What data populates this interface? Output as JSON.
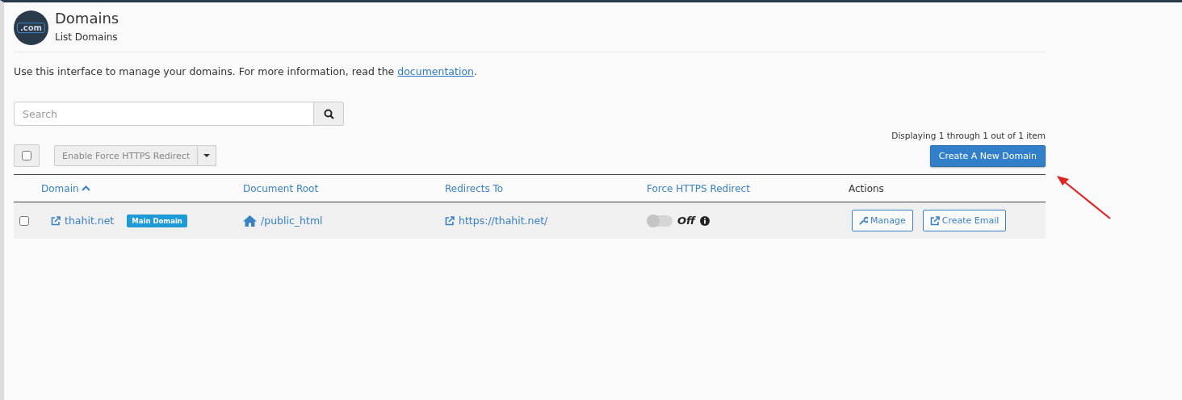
{
  "header": {
    "title": "Domains",
    "subtitle": "List Domains",
    "logo_text": ".com"
  },
  "intro": {
    "text": "Use this interface to manage your domains. For more information, read the ",
    "link": "documentation",
    "end": "."
  },
  "search": {
    "placeholder": "Search"
  },
  "paging": "Displaying 1 through 1 out of 1 item",
  "toolbar": {
    "select_all_checked": false,
    "bulk_action": "Enable Force HTTPS Redirect",
    "bulk_disabled": true,
    "create_button": "Create A New Domain"
  },
  "table": {
    "columns": [
      {
        "label": "Domain",
        "sorted": true,
        "link": true
      },
      {
        "label": "Document Root",
        "sorted": false,
        "link": true
      },
      {
        "label": "Redirects To",
        "sorted": false,
        "link": true
      },
      {
        "label": "Force HTTPS Redirect",
        "sorted": false,
        "link": true
      },
      {
        "label": "Actions",
        "sorted": false,
        "link": false
      }
    ],
    "rows": [
      {
        "checked": false,
        "domain": "thahit.net",
        "badge": "Main Domain",
        "document_root": "/public_html",
        "redirects_to": "https://thahit.net/",
        "force_https": {
          "on": false,
          "label": "Off"
        },
        "actions": [
          {
            "label": "Manage",
            "kind": "wrench"
          },
          {
            "label": "Create Email",
            "kind": "external"
          }
        ]
      }
    ]
  },
  "annotation": {
    "kind": "arrow",
    "color": "#e02424"
  }
}
